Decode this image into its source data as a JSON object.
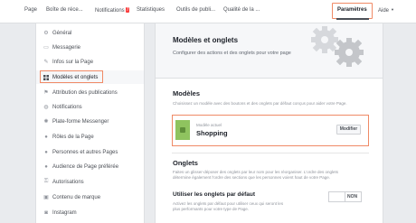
{
  "topnav": {
    "items": [
      "Page",
      "Boîte de réce...",
      "Notifications",
      "Statistiques",
      "Outils de publi...",
      "Qualité de la ..."
    ],
    "notifications_badge": "7",
    "active": "Paramètres",
    "help": "Aide"
  },
  "sidebar": {
    "items": [
      {
        "label": "Général",
        "icon": "gear-icon"
      },
      {
        "label": "Messagerie",
        "icon": "message-icon"
      },
      {
        "label": "Infos sur la Page",
        "icon": "pencil-icon"
      },
      {
        "label": "Modèles et onglets",
        "icon": "grid-icon"
      },
      {
        "label": "Attribution des publications",
        "icon": "flag-icon"
      },
      {
        "label": "Notifications",
        "icon": "globe-icon"
      },
      {
        "label": "Plate-forme Messenger",
        "icon": "messenger-icon"
      },
      {
        "label": "Rôles de la Page",
        "icon": "person-icon"
      },
      {
        "label": "Personnes et autres Pages",
        "icon": "people-icon"
      },
      {
        "label": "Audience de Page préférée",
        "icon": "audience-icon"
      },
      {
        "label": "Autorisations",
        "icon": "key-icon"
      },
      {
        "label": "Contenu de marque",
        "icon": "handshake-icon"
      },
      {
        "label": "Instagram",
        "icon": "instagram-icon"
      }
    ]
  },
  "main": {
    "title": "Modèles et onglets",
    "subtitle": "Configurer des actions et des onglets pour votre page",
    "models": {
      "heading": "Modèles",
      "description": "Choisissez un modèle avec des boutons et des onglets par défaut conçus pour aider votre Page.",
      "current_label": "Modèle actuel",
      "current_name": "Shopping",
      "modify_label": "Modifier"
    },
    "tabs": {
      "heading": "Onglets",
      "description_1": "Faites un glisser-déposer des onglets par leur nom pour les réorganiser. L'ordre des onglets",
      "description_2": "détermine également l'ordre des sections que les personnes voient haut de votre Page."
    },
    "default_tabs": {
      "label": "Utiliser les onglets par défaut",
      "description_1": "Activez les onglets par défaut pour utiliser ceux qui seront les",
      "description_2": "plus performants pour votre type de Page.",
      "toggle_value": "NON"
    }
  }
}
